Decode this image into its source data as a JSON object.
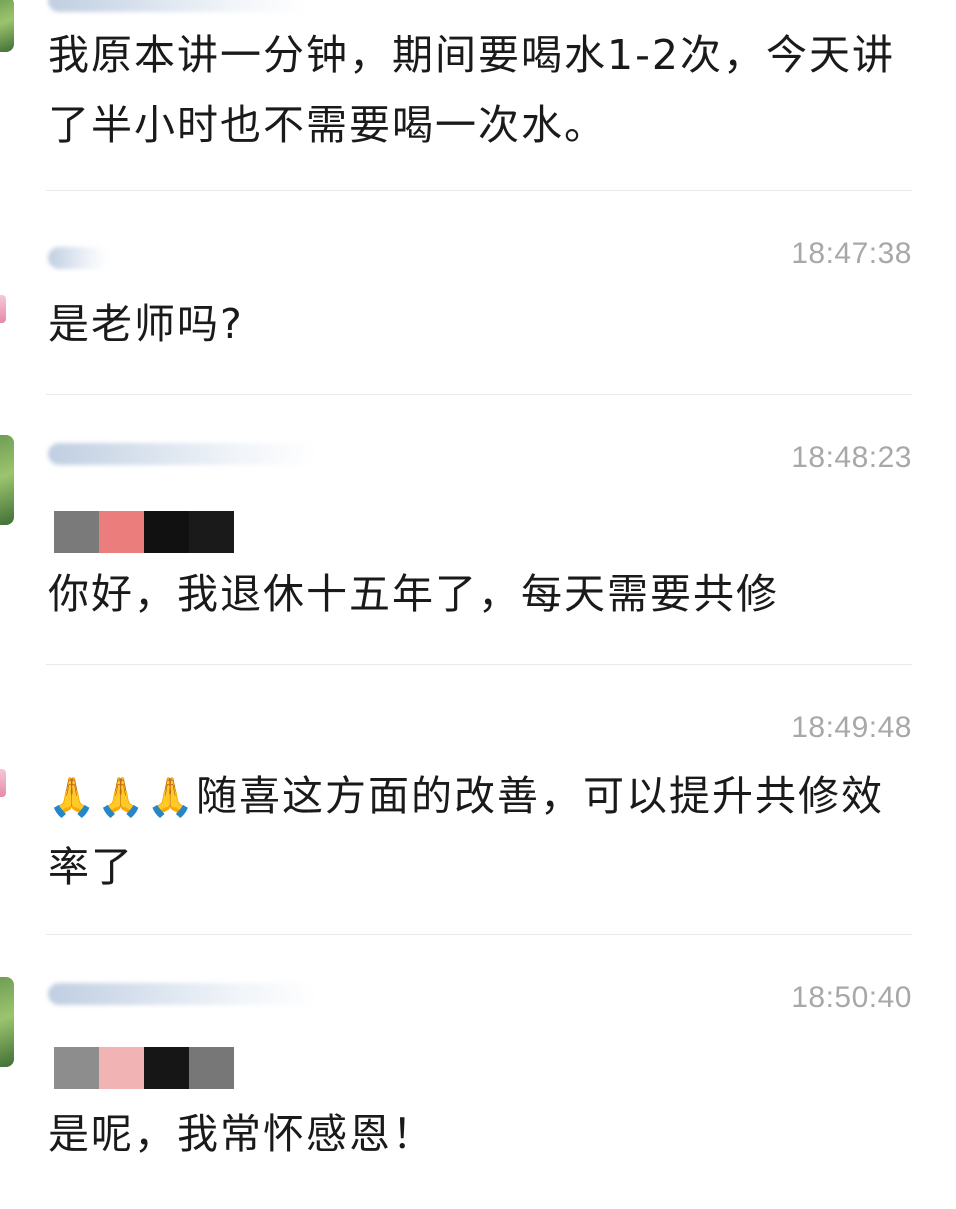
{
  "messages": [
    {
      "id": 1,
      "time": "",
      "text": "我原本讲一分钟，期间要喝水1-2次，今天讲了半小时也不需要喝一次水。"
    },
    {
      "id": 2,
      "time": "18:47:38",
      "text": "是老师吗?"
    },
    {
      "id": 3,
      "time": "18:48:23",
      "text": "你好，我退休十五年了，每天需要共修"
    },
    {
      "id": 4,
      "time": "18:49:48",
      "emoji": "🙏🙏🙏",
      "text": "随喜这方面的改善，可以提升共修效率了"
    },
    {
      "id": 5,
      "time": "18:50:40",
      "text": "是呢，我常怀感恩！"
    }
  ],
  "mosaic_colors": {
    "msg3": [
      "#7a7a7a",
      "#ec7d7d",
      "#111111",
      "#1a1a1a"
    ],
    "msg5": [
      "#8d8d8d",
      "#f1b3b3",
      "#161616",
      "#777777"
    ]
  },
  "colors": {
    "text": "#1a1a1a",
    "time": "#a8a8a8",
    "separator": "#e9e9e9"
  },
  "icons": {
    "reaction": "folded-hands-emoji",
    "avatar": "avatar-thumbnail"
  }
}
